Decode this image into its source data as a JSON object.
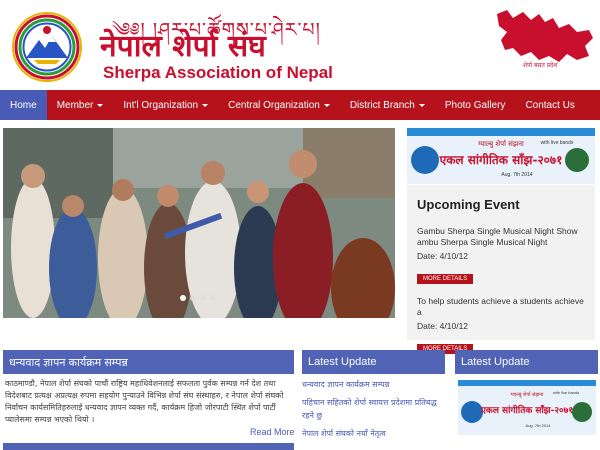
{
  "header": {
    "tibetan_text": "༄༅། །ཤར་པ་ཚོགས་པ་ཤེར་པ།",
    "nepali_title": "नेपाल शेर्पा संघ",
    "english_title": "Sherpa Association of Nepal",
    "map_label": "शेर्पा बसत प्रदेश"
  },
  "nav": {
    "items": [
      {
        "label": "Home",
        "active": true,
        "dropdown": false
      },
      {
        "label": "Member",
        "active": false,
        "dropdown": true
      },
      {
        "label": "Int'l Organization",
        "active": false,
        "dropdown": true
      },
      {
        "label": "Central Organization",
        "active": false,
        "dropdown": true
      },
      {
        "label": "District Branch",
        "active": false,
        "dropdown": true
      },
      {
        "label": "Photo Gallery",
        "active": false,
        "dropdown": false
      },
      {
        "label": "Contact Us",
        "active": false,
        "dropdown": false
      }
    ]
  },
  "slider": {
    "dots": 4,
    "active_dot": 0
  },
  "upcoming": {
    "title": "Upcoming Event",
    "events": [
      {
        "text": "Gambu Sherpa Single Musical Night Show ambu Sherpa Single Musical Night",
        "date": "Date: 4/10/12",
        "button": "MORE DETAILS"
      },
      {
        "text": "To help students achieve a students achieve a",
        "date": "Date: 4/10/12",
        "button": "MORE DETAILS"
      }
    ]
  },
  "banner": {
    "top_text": "ग्याल्बु शेर्पा संझना",
    "main_text": "एकल सांगीतिक साँझ-२०७१",
    "side_text": "with live bands",
    "date_text": "Aug. 7th 2014"
  },
  "panels": {
    "news_title": "धन्यवाद ज्ञापन कार्यक्रम सम्पन्न",
    "news_body": "काठमाण्डौ, नेपाल शेर्पा संघको पाचौं राष्ट्रिय महाधिवेशनलाई सफलता पुर्वक सम्पन्न गर्न देश तथा विदेशबाट प्रत्यक्ष अप्रत्यक्ष रुपमा सहयोग पुर्‍याउने विभिन्न शेर्पा संघ संस्थाहरु, र नेपाल शेर्पा संघको निर्वाचन कार्यसमितिहरुलाई धन्यवाद ज्ञापन व्यक्त गर्दै, कार्यक्रम हिजो जोरपाटी स्थित शेर्पा पार्टी प्यालेसमा सम्पन्न भएको थियो ।",
    "read_more": "Read More",
    "latest_title_1": "Latest Update",
    "latest_title_2": "Latest Update",
    "latest_items": [
      "धन्यवाद ज्ञापन कार्यक्रम सम्पन्न",
      "पहिचान सहितको शेर्पा स्वायत्त प्रदेशमा प्रतिबद्ध रहने छु",
      "नेपाल शेर्पा संघको नयाँ नेतृत्व"
    ]
  },
  "colors": {
    "brand_red": "#b5121b",
    "nav_active": "#4a5bb6",
    "panel_blue": "#5063b5"
  }
}
